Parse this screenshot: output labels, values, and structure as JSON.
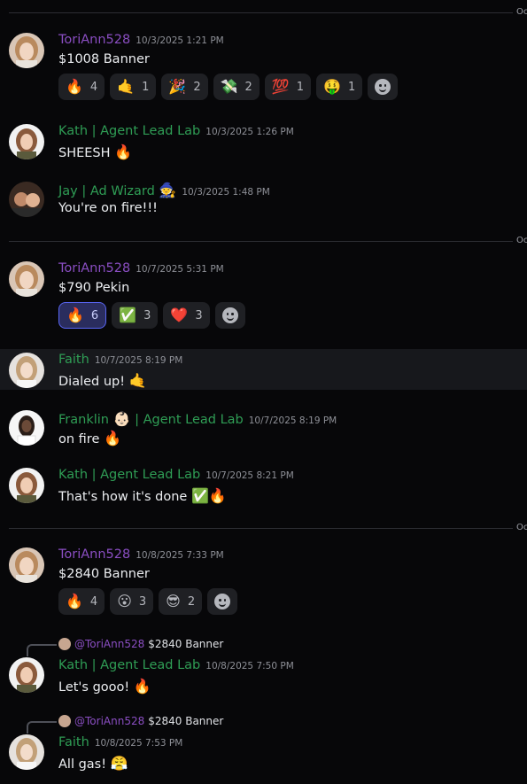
{
  "dividers": [
    {
      "label": "Oc"
    },
    {
      "label": "Oc"
    },
    {
      "label": "Oc"
    }
  ],
  "messages": [
    {
      "user": "ToriAnn528",
      "time": "10/3/2025 1:21 PM",
      "text": "$1008 Banner",
      "reactions": [
        {
          "emoji": "🔥",
          "count": "4"
        },
        {
          "emoji": "🤙",
          "count": "1"
        },
        {
          "emoji": "🎉",
          "count": "2"
        },
        {
          "emoji": "💸",
          "count": "2"
        },
        {
          "emoji": "💯",
          "count": "1"
        },
        {
          "emoji": "🤑",
          "count": "1"
        }
      ]
    },
    {
      "user": "Kath | Agent Lead Lab",
      "time": "10/3/2025 1:26 PM",
      "text": "SHEESH",
      "emoji": "🔥"
    },
    {
      "user": "Jay | Ad Wizard",
      "user_emoji": "🧙",
      "time": "10/3/2025 1:48 PM",
      "text": "You're on fire!!!"
    },
    {
      "user": "ToriAnn528",
      "time": "10/7/2025 5:31 PM",
      "text": "$790 Pekin",
      "reactions": [
        {
          "emoji": "🔥",
          "count": "6"
        },
        {
          "emoji": "✅",
          "count": "3"
        },
        {
          "emoji": "❤️",
          "count": "3"
        }
      ]
    },
    {
      "user": "Faith",
      "time": "10/7/2025 8:19 PM",
      "text": "Dialed up!",
      "emoji": "🤙"
    },
    {
      "user_prefix": "Franklin",
      "user_emoji": "👶🏻",
      "user_suffix": "| Agent Lead Lab",
      "time": "10/7/2025 8:19 PM",
      "text": "on fire",
      "emoji": "🔥"
    },
    {
      "user": "Kath | Agent Lead Lab",
      "time": "10/7/2025 8:21 PM",
      "text": "That's how it's done",
      "emoji": "✅🔥"
    },
    {
      "user": "ToriAnn528",
      "time": "10/8/2025 7:33 PM",
      "text": "$2840 Banner",
      "reactions": [
        {
          "emoji": "🔥",
          "count": "4"
        },
        {
          "emoji": "😮",
          "count": "3"
        },
        {
          "emoji": "😎",
          "count": "2"
        }
      ]
    },
    {
      "reply_name": "@ToriAnn528",
      "reply_text": "$2840 Banner",
      "user": "Kath | Agent Lead Lab",
      "time": "10/8/2025 7:50 PM",
      "text": "Let's gooo!",
      "emoji": "🔥"
    },
    {
      "reply_name": "@ToriAnn528",
      "reply_text": "$2840 Banner",
      "user": "Faith",
      "time": "10/8/2025 7:53 PM",
      "text": "All gas!",
      "emoji": "😤"
    }
  ],
  "colors": {
    "background": "#070709",
    "purple_name": "#8a4ec2",
    "green_name": "#2f9d55",
    "active_reaction": "#5865f2"
  },
  "icons": {
    "add_reaction": "add-reaction-icon"
  }
}
